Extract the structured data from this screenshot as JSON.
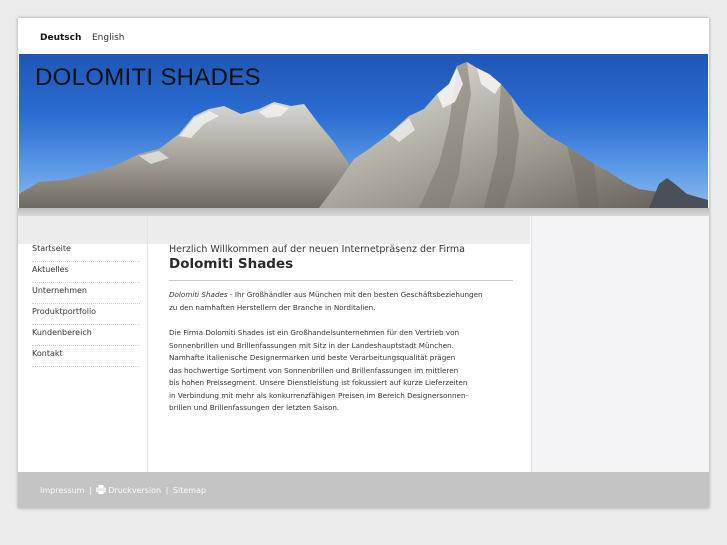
{
  "languages": {
    "active": "Deutsch",
    "other": "English"
  },
  "header": {
    "title": "DOLOMITI SHADES"
  },
  "nav": {
    "items": [
      {
        "label": "Startseite"
      },
      {
        "label": "Aktuelles"
      },
      {
        "label": "Unternehmen"
      },
      {
        "label": "Produktportfolio"
      },
      {
        "label": "Kundenbereich"
      },
      {
        "label": "Kontakt"
      }
    ]
  },
  "main": {
    "welcome": "Herzlich Willkommen auf der neuen Internetpräsenz der Firma",
    "company": "Dolomiti Shades",
    "intro_company": "Dolomiti Shades",
    "intro_line1": " - Ihr Großhändler aus München mit den besten Geschäftsbeziehungen",
    "intro_line2": "zu den namhaften Herstellern der Branche in Norditalien.",
    "para2_lines": [
      "Die Firma Dolomiti Shades ist ein Großhandelsunternehmen für den Vertrieb von",
      "Sonnenbrillen und Brillenfassungen mit Sitz in der Landeshauptstadt München.",
      "Namhafte italienische Designermarken und beste Verarbeitungsqualität prägen",
      "das hochwertige Sortiment von Sonnenbrillen und Brillenfassungen im mittleren",
      "bis hohen Preissegment. Unsere Dienstleistung ist fokussiert auf kurze Lieferzeiten",
      "in Verbindung mit mehr als konkurrenzfähigen Preisen im Bereich Designersonnen-",
      "brillen und Brillenfassungen der letzten Saison."
    ]
  },
  "footer": {
    "impressum": "Impressum",
    "druckversion": "Druckversion",
    "sitemap": "Sitemap",
    "separator": "|"
  },
  "icons": {
    "print": "printer-icon"
  },
  "colors": {
    "banner_sky": "#2b6dd2",
    "footer_bg": "#c4c4c4",
    "right_col_bg": "#f4f4f6"
  }
}
